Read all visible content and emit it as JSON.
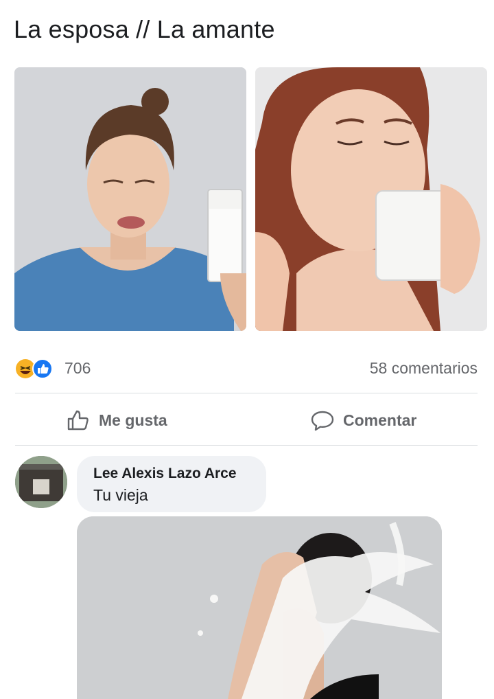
{
  "post": {
    "text": "La esposa // La amante"
  },
  "stats": {
    "reaction_icons": [
      "haha-icon",
      "like-icon"
    ],
    "reaction_count": "706",
    "comment_count": "58 comentarios"
  },
  "actions": {
    "like_label": "Me gusta",
    "comment_label": "Comentar"
  },
  "comment": {
    "author": "Lee Alexis Lazo Arce",
    "text": "Tu vieja"
  },
  "colors": {
    "like_blue": "#1877f2",
    "haha_yellow": "#f7b125",
    "secondary_text": "#65676b",
    "bubble_bg": "#f0f2f5"
  }
}
